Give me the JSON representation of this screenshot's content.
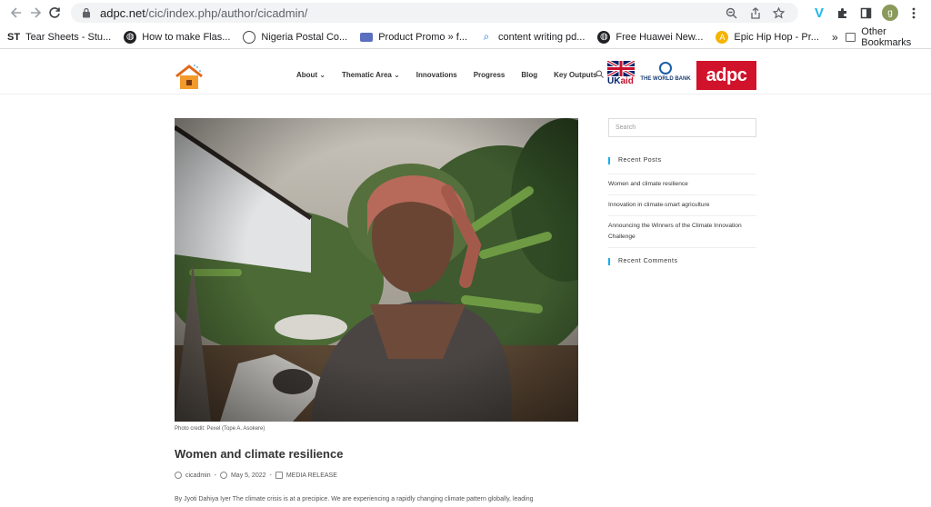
{
  "browser": {
    "url_host": "adpc.net",
    "url_path": "/cic/index.php/author/cicadmin/",
    "profile_initial": "g"
  },
  "bookmarks": [
    {
      "icon": "st",
      "label": "Tear Sheets - Stu..."
    },
    {
      "icon": "globe",
      "label": "How to make Flas..."
    },
    {
      "icon": "ng",
      "label": "Nigeria Postal Co..."
    },
    {
      "icon": "pp",
      "label": "Product Promo » f..."
    },
    {
      "icon": "search",
      "label": "content writing pd..."
    },
    {
      "icon": "globe",
      "label": "Free Huawei New..."
    },
    {
      "icon": "epic",
      "label": "Epic Hip Hop - Pr..."
    }
  ],
  "bookmarks_more": "»",
  "other_bookmarks": "Other Bookmarks",
  "site": {
    "nav": [
      "About ⌄",
      "Thematic Area ⌄",
      "Innovations",
      "Progress",
      "Blog",
      "Key Outputs"
    ],
    "ukaid_text_uk": "UK",
    "ukaid_text_aid": "aid",
    "worldbank_text": "THE WORLD BANK",
    "adpc_text": "adpc"
  },
  "post": {
    "caption": "Photo credit: Pexel (Tope A. Asokere)",
    "title": "Women and climate resilience",
    "author": "cicadmin",
    "date": "May 5, 2022",
    "category": "MEDIA RELEASE",
    "excerpt": "By Jyoti Dahiya Iyer The climate crisis is at a precipice. We are experiencing a rapidly changing climate pattern globally, leading"
  },
  "sidebar": {
    "search_placeholder": "Search",
    "recent_posts_title": "Recent Posts",
    "recent_posts": [
      "Women and climate resilience",
      "Innovation in climate-smart agriculture",
      "Announcing the Winners of the Climate Innovation Challenge"
    ],
    "recent_comments_title": "Recent Comments"
  }
}
